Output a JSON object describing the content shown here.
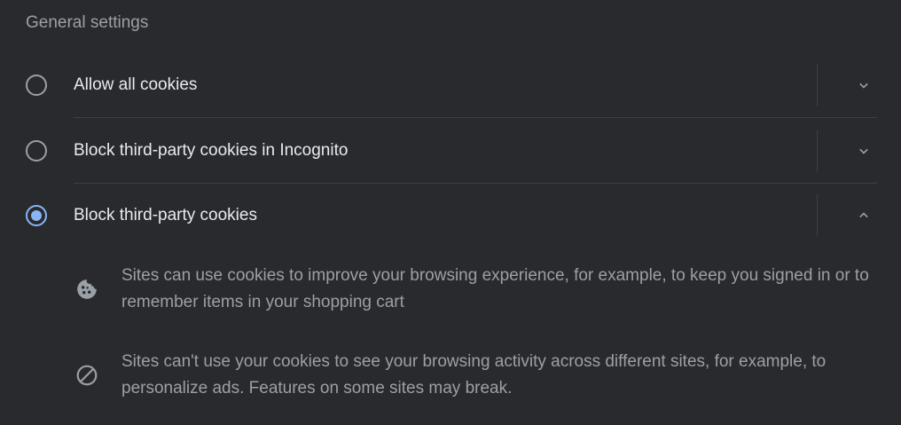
{
  "section": {
    "title": "General settings"
  },
  "options": [
    {
      "label": "Allow all cookies",
      "selected": false,
      "expanded": false
    },
    {
      "label": "Block third-party cookies in Incognito",
      "selected": false,
      "expanded": false
    },
    {
      "label": "Block third-party cookies",
      "selected": true,
      "expanded": true
    }
  ],
  "details": [
    {
      "icon": "cookie-icon",
      "text": "Sites can use cookies to improve your browsing experience, for example, to keep you signed in or to remember items in your shopping cart"
    },
    {
      "icon": "block-icon",
      "text": "Sites can't use your cookies to see your browsing activity across different sites, for example, to personalize ads. Features on some sites may break."
    }
  ],
  "colors": {
    "background": "#292a2d",
    "accent": "#8ab4f8",
    "primary_text": "#e8eaed",
    "secondary_text": "#9aa0a6",
    "separator": "#3c4043"
  }
}
